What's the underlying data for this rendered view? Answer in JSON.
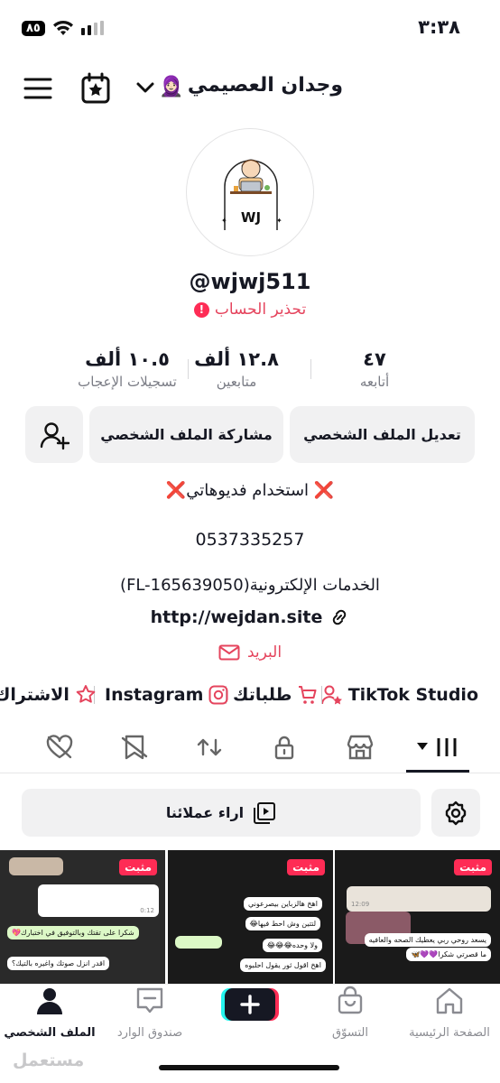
{
  "status_bar": {
    "time": "٣:٣٨",
    "battery": "٨٥"
  },
  "header": {
    "name": "وجدان العصيمي",
    "emoji": "🧕🏻",
    "icons": [
      "chevron-down-icon",
      "calendar-star-icon",
      "menu-icon"
    ]
  },
  "avatar": {
    "initials": "WJ"
  },
  "profile": {
    "username": "@wjwj511",
    "warning": "تحذير الحساب"
  },
  "stats": [
    {
      "value": "٤٧",
      "label": "أتابعه"
    },
    {
      "value": "١٢.٨ ألف",
      "label": "متابعين"
    },
    {
      "value": "١٠.٥ ألف",
      "label": "تسجيلات الإعجاب"
    }
  ],
  "buttons": {
    "edit": "تعديل الملف الشخصي",
    "share": "مشاركة الملف الشخصي"
  },
  "bio": {
    "line1": "❌ استخدام فديوهاتي❌",
    "phone": "0537335257",
    "services": "الخدمات الإلكترونية(FL-165639050)",
    "link": "http://wejdan.site",
    "email": "البريد"
  },
  "shortcuts": {
    "tiktok_studio": "TikTok Studio",
    "orders": "طلباتك",
    "instagram": "Instagram",
    "subscription": "الاشتراك"
  },
  "filter": {
    "label": "اراء عملائنا"
  },
  "thumbnails": [
    {
      "pin": "مثبت",
      "bubbles": [
        "يسعد روحي ربي يعطيك الصحه والعافيه",
        "ما قصرتي شكرا💜💜🦋",
        "12:09"
      ]
    },
    {
      "pin": "مثبت",
      "bubbles": [
        "اهخ هالزباين بيصرعوني",
        "لتتين وش احط فيها😂",
        "ولا وحده😂😂😂",
        "اهخ اقول ثور يقول احلبوه"
      ]
    },
    {
      "pin": "مثبت",
      "bubbles": [
        "شكرا على تقتك وبالتوفيق في اختبارك💖",
        "اقدر انزل صوتك واغيره بالتيك؟",
        "0:12"
      ]
    }
  ],
  "bottom_nav": [
    {
      "label": "الصفحة الرئيسية",
      "icon": "home-icon"
    },
    {
      "label": "التسوّق",
      "icon": "shop-bag-icon"
    },
    {
      "label": "",
      "icon": "plus-icon"
    },
    {
      "label": "صندوق الوارد",
      "icon": "inbox-icon"
    },
    {
      "label": "الملف الشخصي",
      "icon": "profile-icon"
    }
  ],
  "watermark": "مستعمل",
  "colors": {
    "accent": "#fe2c55",
    "warning_text": "#e5445d",
    "button_bg": "#f1f1f2",
    "text": "#161823"
  }
}
